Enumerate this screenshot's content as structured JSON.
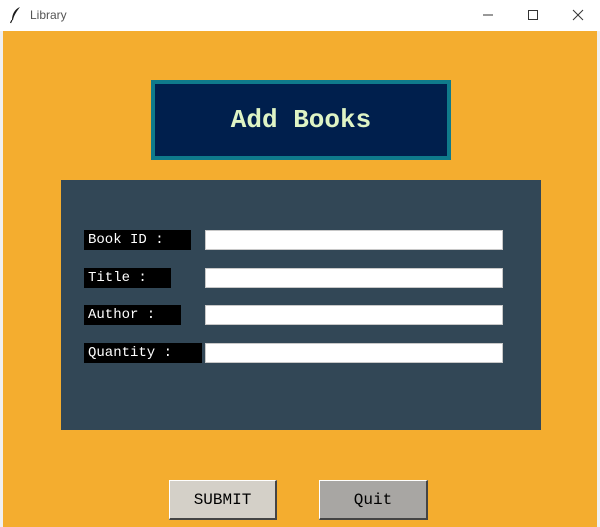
{
  "window": {
    "title": "Library",
    "icon": "feather-icon"
  },
  "header": {
    "title": "Add Books"
  },
  "form": {
    "fields": [
      {
        "label": "Book ID : ",
        "value": ""
      },
      {
        "label": "Title : ",
        "value": ""
      },
      {
        "label": "Author : ",
        "value": ""
      },
      {
        "label": "Quantity : ",
        "value": ""
      }
    ]
  },
  "buttons": {
    "submit_label": "SUBMIT",
    "quit_label": "Quit"
  },
  "colors": {
    "background": "#f4ad2f",
    "header_border": "#0f7a8b",
    "header_fill": "#001f4d",
    "header_text": "#dff4c5",
    "panel": "#324756",
    "label_bg": "#000000"
  }
}
